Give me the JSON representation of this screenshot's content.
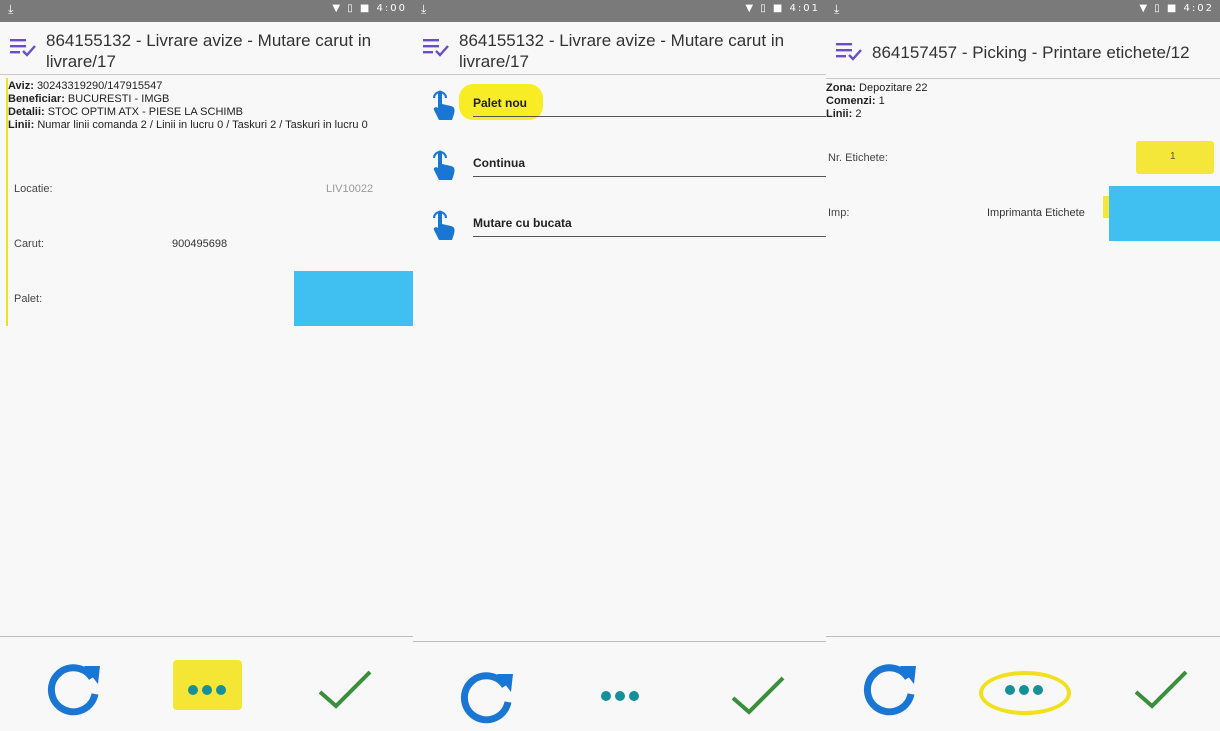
{
  "colors": {
    "accent_blue": "#1976d2",
    "check_green": "#3a8f3a",
    "highlight_yellow": "#f5e63a",
    "field_blue": "#40c0f0",
    "dots_teal": "#178f9a"
  },
  "screens": [
    {
      "status": {
        "time": "4:00"
      },
      "title": "864155132 - Livrare avize - Mutare carut in livrare/17",
      "info": [
        {
          "label": "Aviz:",
          "value": "30243319290/147915547"
        },
        {
          "label": "Beneficiar:",
          "value": "BUCURESTI - IMGB"
        },
        {
          "label": "Detalii:",
          "value": "STOC OPTIM ATX - PIESE LA SCHIMB"
        },
        {
          "label": "Linii:",
          "value": "Numar linii comanda 2 / Linii in lucru 0 / Taskuri 2 / Taskuri in lucru 0"
        }
      ],
      "fields": {
        "locatie_label": "Locatie:",
        "locatie_value": "LIV10022",
        "carut_label": "Carut:",
        "carut_value": "900495698",
        "palet_label": "Palet:"
      },
      "footer": {
        "refresh_icon": "refresh-icon",
        "more_icon": "more-dots-icon",
        "confirm_icon": "check-icon"
      }
    },
    {
      "status": {
        "time": "4:01"
      },
      "title": "864155132 - Livrare avize - Mutare carut in livrare/17",
      "actions": [
        {
          "label": "Palet nou",
          "icon": "hand-pointer-icon"
        },
        {
          "label": "Continua",
          "icon": "hand-pointer-icon"
        },
        {
          "label": "Mutare cu bucata",
          "icon": "hand-pointer-icon"
        }
      ]
    },
    {
      "status": {
        "time": "4:02"
      },
      "title": "864157457 - Picking - Printare etichete/12",
      "info": [
        {
          "label": "Zona:",
          "value": "Depozitare 22"
        },
        {
          "label": "Comenzi:",
          "value": "1"
        },
        {
          "label": "Linii:",
          "value": "2"
        }
      ],
      "fields": {
        "etichete_label": "Nr. Etichete:",
        "etichete_value": "1",
        "imp_label": "Imp:",
        "imp_value": "Imprimanta Etichete"
      }
    }
  ]
}
